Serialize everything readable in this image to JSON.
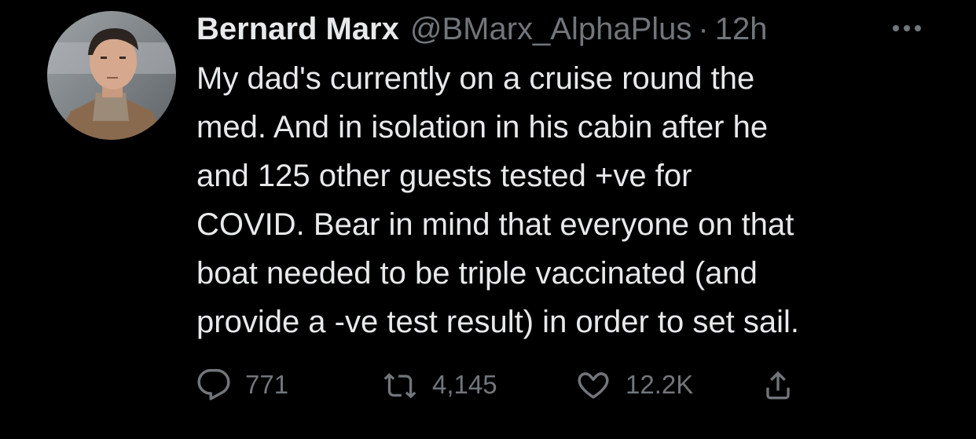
{
  "tweet": {
    "author_name": "Bernard Marx",
    "handle": "@BMarx_AlphaPlus",
    "separator": "·",
    "time": "12h",
    "body_lines": [
      "My dad's currently on a cruise round the",
      "med. And in isolation in his cabin after he",
      "and 125 other guests tested +ve for",
      "COVID. Bear in mind that everyone on that",
      "boat needed to be triple vaccinated (and",
      "provide a -ve test result) in order to set sail."
    ],
    "actions": {
      "reply": {
        "icon": "reply-icon",
        "count": "771"
      },
      "retweet": {
        "icon": "retweet-icon",
        "count": "4,145"
      },
      "like": {
        "icon": "heart-icon",
        "count": "12.2K"
      },
      "share": {
        "icon": "share-icon"
      }
    },
    "more_icon": "more-options-icon"
  },
  "colors": {
    "background": "#000000",
    "primary_text": "#e7e9ea",
    "secondary_text": "#71767b"
  }
}
